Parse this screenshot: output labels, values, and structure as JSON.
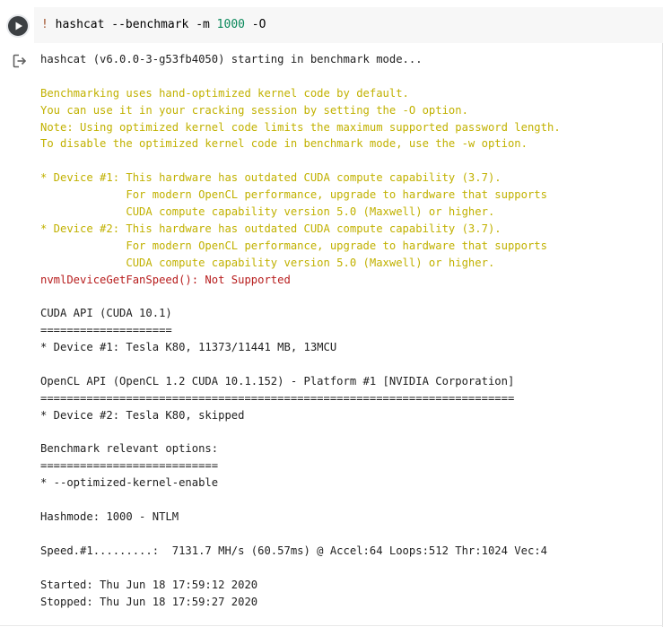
{
  "code_cell": {
    "command_bang": "!",
    "command_text": " hashcat --benchmark -m ",
    "command_mode": "1000",
    "command_flag": " -O"
  },
  "output": {
    "lines": [
      {
        "text": "hashcat (v6.0.0-3-g53fb4050) starting in benchmark mode...",
        "style": "normal"
      },
      {
        "text": "",
        "style": "normal"
      },
      {
        "text": "Benchmarking uses hand-optimized kernel code by default.",
        "style": "warn"
      },
      {
        "text": "You can use it in your cracking session by setting the -O option.",
        "style": "warn"
      },
      {
        "text": "Note: Using optimized kernel code limits the maximum supported password length.",
        "style": "warn"
      },
      {
        "text": "To disable the optimized kernel code in benchmark mode, use the -w option.",
        "style": "warn"
      },
      {
        "text": "",
        "style": "normal"
      },
      {
        "text": "* Device #1: This hardware has outdated CUDA compute capability (3.7).",
        "style": "warn"
      },
      {
        "text": "             For modern OpenCL performance, upgrade to hardware that supports",
        "style": "warn"
      },
      {
        "text": "             CUDA compute capability version 5.0 (Maxwell) or higher.",
        "style": "warn"
      },
      {
        "text": "* Device #2: This hardware has outdated CUDA compute capability (3.7).",
        "style": "warn"
      },
      {
        "text": "             For modern OpenCL performance, upgrade to hardware that supports",
        "style": "warn"
      },
      {
        "text": "             CUDA compute capability version 5.0 (Maxwell) or higher.",
        "style": "warn"
      },
      {
        "text": "nvmlDeviceGetFanSpeed(): Not Supported",
        "style": "err"
      },
      {
        "text": "",
        "style": "normal"
      },
      {
        "text": "CUDA API (CUDA 10.1)",
        "style": "normal"
      },
      {
        "text": "====================",
        "style": "normal"
      },
      {
        "text": "* Device #1: Tesla K80, 11373/11441 MB, 13MCU",
        "style": "normal"
      },
      {
        "text": "",
        "style": "normal"
      },
      {
        "text": "OpenCL API (OpenCL 1.2 CUDA 10.1.152) - Platform #1 [NVIDIA Corporation]",
        "style": "normal"
      },
      {
        "text": "========================================================================",
        "style": "normal"
      },
      {
        "text": "* Device #2: Tesla K80, skipped",
        "style": "normal"
      },
      {
        "text": "",
        "style": "normal"
      },
      {
        "text": "Benchmark relevant options:",
        "style": "normal"
      },
      {
        "text": "===========================",
        "style": "normal"
      },
      {
        "text": "* --optimized-kernel-enable",
        "style": "normal"
      },
      {
        "text": "",
        "style": "normal"
      },
      {
        "text": "Hashmode: 1000 - NTLM",
        "style": "normal"
      },
      {
        "text": "",
        "style": "normal"
      },
      {
        "text": "Speed.#1.........:  7131.7 MH/s (60.57ms) @ Accel:64 Loops:512 Thr:1024 Vec:4",
        "style": "normal"
      },
      {
        "text": "",
        "style": "normal"
      },
      {
        "text": "Started: Thu Jun 18 17:59:12 2020",
        "style": "normal"
      },
      {
        "text": "Stopped: Thu Jun 18 17:59:27 2020",
        "style": "normal"
      }
    ]
  },
  "icons": {
    "run": "play-circle-icon",
    "output": "output-redirect-icon"
  },
  "colors": {
    "run_button": "#3c4043",
    "editor_background": "#f7f7f7",
    "warning_text": "#c1b100",
    "error_text": "#b71c1c",
    "number_token": "#09885a"
  }
}
